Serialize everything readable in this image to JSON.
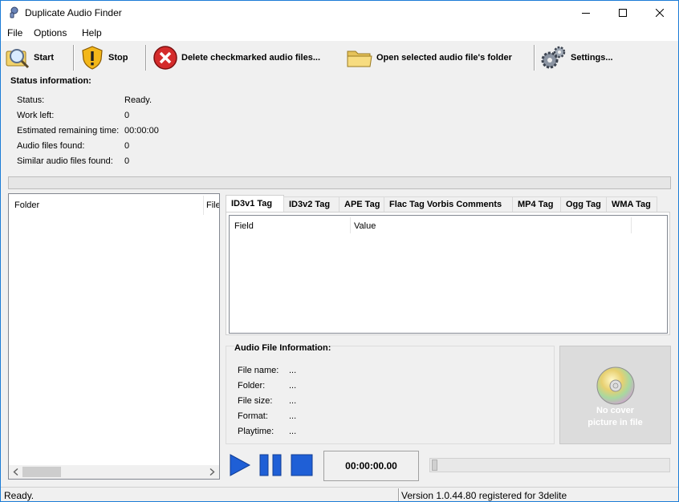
{
  "window": {
    "title": "Duplicate Audio Finder"
  },
  "menu": [
    "File",
    "Options",
    "Help"
  ],
  "toolbar": {
    "start": "Start",
    "stop": "Stop",
    "delete": "Delete checkmarked audio files...",
    "open_folder": "Open selected audio file's folder",
    "settings": "Settings..."
  },
  "status": {
    "title": "Status information:",
    "rows": [
      {
        "label": "Status:",
        "value": "Ready."
      },
      {
        "label": "Work left:",
        "value": "0"
      },
      {
        "label": "Estimated remaining time:",
        "value": "00:00:00"
      },
      {
        "label": "Audio files found:",
        "value": "0"
      },
      {
        "label": "Similar audio files found:",
        "value": "0"
      }
    ]
  },
  "file_list": {
    "columns": [
      "Folder",
      "File"
    ]
  },
  "tabs": [
    "ID3v1 Tag",
    "ID3v2 Tag",
    "APE Tag",
    "Flac Tag Vorbis Comments",
    "MP4 Tag",
    "Ogg Tag",
    "WMA Tag"
  ],
  "active_tab": "ID3v1 Tag",
  "tag_list": {
    "columns": [
      "Field",
      "Value"
    ]
  },
  "audio_info": {
    "title": "Audio File Information:",
    "rows": [
      {
        "label": "File name:",
        "value": "..."
      },
      {
        "label": "Folder:",
        "value": "..."
      },
      {
        "label": "File size:",
        "value": "..."
      },
      {
        "label": "Format:",
        "value": "..."
      },
      {
        "label": "Playtime:",
        "value": "..."
      }
    ]
  },
  "cover": {
    "line1": "No cover",
    "line2": "picture in file"
  },
  "player": {
    "time": "00:00:00.00",
    "position": 0
  },
  "statusbar": {
    "left": "Ready.",
    "right": "Version 1.0.44.80 registered for 3delite"
  },
  "colors": {
    "accent": "#1c7cd6",
    "player_blue": "#1f5fd6",
    "delete_red": "#d42b2b"
  }
}
